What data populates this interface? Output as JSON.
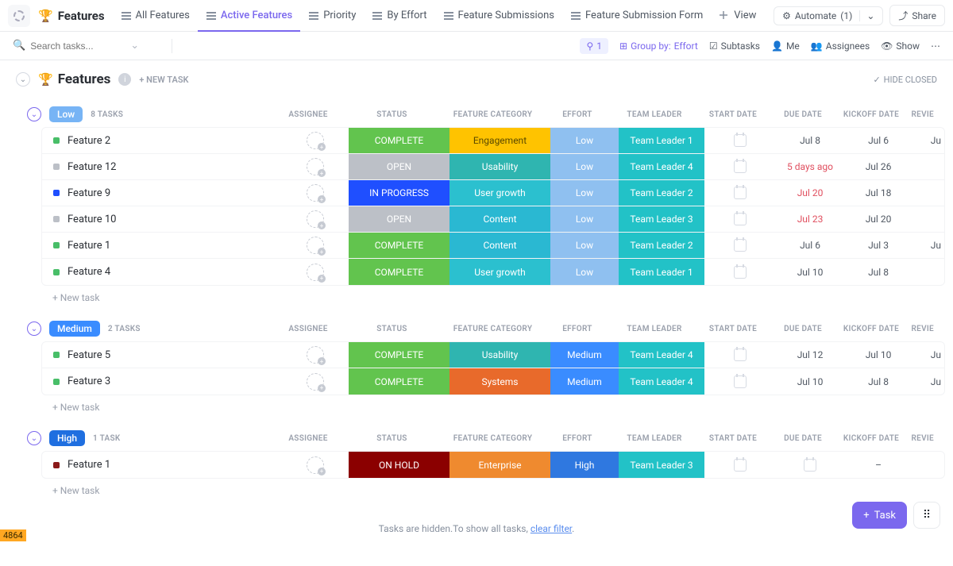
{
  "header": {
    "title": "Features",
    "views": [
      {
        "label": "All Features"
      },
      {
        "label": "Active Features",
        "active": true
      },
      {
        "label": "Priority"
      },
      {
        "label": "By Effort"
      },
      {
        "label": "Feature Submissions"
      },
      {
        "label": "Feature Submission Form"
      },
      {
        "label": "View",
        "plus": true
      }
    ],
    "automate_label": "Automate",
    "automate_count": "(1)",
    "share_label": "Share"
  },
  "subbar": {
    "search_placeholder": "Search tasks...",
    "filter_count": "1",
    "group_by_label": "Group by:",
    "group_by_value": "Effort",
    "subtasks": "Subtasks",
    "me": "Me",
    "assignees": "Assignees",
    "show": "Show"
  },
  "list": {
    "title": "Features",
    "new_task_top": "+ NEW TASK",
    "hide_closed": "HIDE CLOSED"
  },
  "columns": {
    "assignee": "ASSIGNEE",
    "status": "STATUS",
    "category": "FEATURE CATEGORY",
    "effort": "EFFORT",
    "leader": "TEAM LEADER",
    "start": "START DATE",
    "due": "DUE DATE",
    "kickoff": "KICKOFF DATE",
    "review": "REVIE"
  },
  "groups": [
    {
      "name": "Low",
      "badge_class": "badge-low",
      "count": "8 TASKS",
      "rows": [
        {
          "name": "Feature 2",
          "dot": "dot-green",
          "status": "COMPLETE",
          "status_class": "st-complete",
          "cat": "Engagement",
          "cat_class": "cat-eng",
          "eff": "Low",
          "eff_class": "eff-low",
          "leader": "Team Leader 1",
          "leader_class": "lead1",
          "due": "Jul 8",
          "due_over": false,
          "kick": "Jul 6",
          "review": "Ju"
        },
        {
          "name": "Feature 12",
          "dot": "dot-grey",
          "status": "OPEN",
          "status_class": "st-open",
          "cat": "Usability",
          "cat_class": "cat-usa",
          "eff": "Low",
          "eff_class": "eff-low",
          "leader": "Team Leader 4",
          "leader_class": "lead4",
          "due": "5 days ago",
          "due_over": true,
          "kick": "Jul 26",
          "review": ""
        },
        {
          "name": "Feature 9",
          "dot": "dot-blue",
          "status": "IN PROGRESS",
          "status_class": "st-progress",
          "cat": "User growth",
          "cat_class": "cat-ugrow",
          "eff": "Low",
          "eff_class": "eff-low",
          "leader": "Team Leader 2",
          "leader_class": "lead2",
          "due": "Jul 20",
          "due_over": true,
          "kick": "Jul 18",
          "review": ""
        },
        {
          "name": "Feature 10",
          "dot": "dot-grey",
          "status": "OPEN",
          "status_class": "st-open",
          "cat": "Content",
          "cat_class": "cat-content",
          "eff": "Low",
          "eff_class": "eff-low",
          "leader": "Team Leader 3",
          "leader_class": "lead3",
          "due": "Jul 23",
          "due_over": true,
          "kick": "Jul 20",
          "review": ""
        },
        {
          "name": "Feature 1",
          "dot": "dot-green",
          "status": "COMPLETE",
          "status_class": "st-complete",
          "cat": "Content",
          "cat_class": "cat-content",
          "eff": "Low",
          "eff_class": "eff-low",
          "leader": "Team Leader 2",
          "leader_class": "lead2",
          "due": "Jul 6",
          "due_over": false,
          "kick": "Jul 3",
          "review": "Ju"
        },
        {
          "name": "Feature 4",
          "dot": "dot-green",
          "status": "COMPLETE",
          "status_class": "st-complete",
          "cat": "User growth",
          "cat_class": "cat-ugrow",
          "eff": "Low",
          "eff_class": "eff-low",
          "leader": "Team Leader 1",
          "leader_class": "lead1",
          "due": "Jul 10",
          "due_over": false,
          "kick": "Jul 8",
          "review": ""
        }
      ],
      "new_task": "+ New task"
    },
    {
      "name": "Medium",
      "badge_class": "badge-med",
      "count": "2 TASKS",
      "rows": [
        {
          "name": "Feature 5",
          "dot": "dot-green",
          "status": "COMPLETE",
          "status_class": "st-complete",
          "cat": "Usability",
          "cat_class": "cat-usa",
          "eff": "Medium",
          "eff_class": "eff-med",
          "leader": "Team Leader 4",
          "leader_class": "lead4",
          "due": "Jul 12",
          "due_over": false,
          "kick": "Jul 10",
          "review": "Ju"
        },
        {
          "name": "Feature 3",
          "dot": "dot-green",
          "status": "COMPLETE",
          "status_class": "st-complete",
          "cat": "Systems",
          "cat_class": "cat-sys",
          "eff": "Medium",
          "eff_class": "eff-med",
          "leader": "Team Leader 4",
          "leader_class": "lead4",
          "due": "Jul 10",
          "due_over": false,
          "kick": "Jul 8",
          "review": "Ju"
        }
      ],
      "new_task": "+ New task"
    },
    {
      "name": "High",
      "badge_class": "badge-high",
      "count": "1 TASK",
      "rows": [
        {
          "name": "Feature 1",
          "dot": "dot-darkred",
          "status": "ON HOLD",
          "status_class": "st-hold",
          "cat": "Enterprise",
          "cat_class": "cat-ent",
          "eff": "High",
          "eff_class": "eff-high",
          "leader": "Team Leader 3",
          "leader_class": "lead3",
          "due": "",
          "due_over": false,
          "due_cal": true,
          "kick": "–",
          "review": ""
        }
      ],
      "new_task": "+ New task"
    }
  ],
  "footer": {
    "hidden_pre": "Tasks are hidden.To show all tasks, ",
    "hidden_link": "clear filter",
    "hidden_post": "."
  },
  "fab": {
    "task": "Task"
  },
  "badge_num": "4864"
}
